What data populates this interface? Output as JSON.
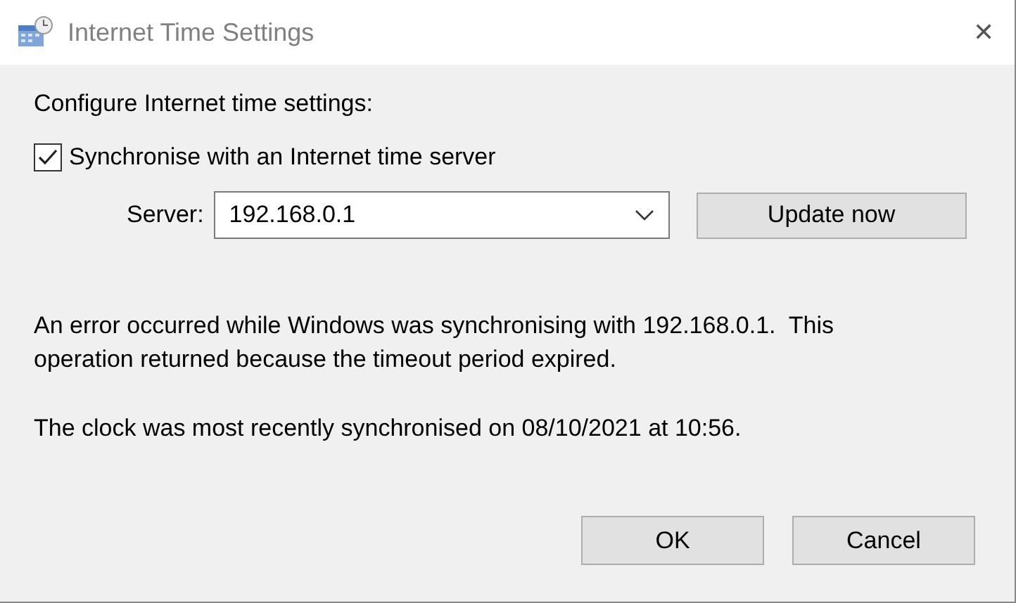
{
  "window": {
    "title": "Internet Time Settings",
    "close": "✕"
  },
  "heading": "Configure Internet time settings:",
  "sync": {
    "label": "Synchronise with an Internet time server",
    "checked": true
  },
  "server": {
    "label": "Server:",
    "value": "192.168.0.1"
  },
  "update_button": "Update now",
  "error_lines": [
    "An error occurred while Windows was synchronising with 192.168.0.1.  This",
    "operation returned because the timeout period expired."
  ],
  "last_sync": "The clock was most recently synchronised on 08/10/2021 at 10:56.",
  "buttons": [
    "OK",
    "Cancel"
  ]
}
